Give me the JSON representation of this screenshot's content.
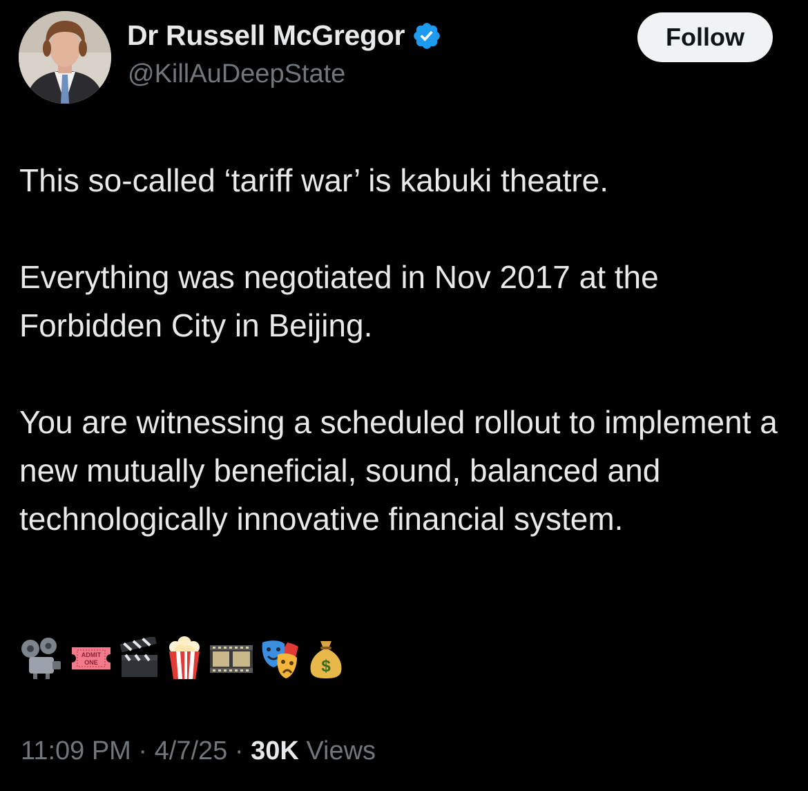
{
  "author": {
    "display_name": "Dr Russell McGregor",
    "handle": "@KillAuDeepState",
    "verified": true,
    "verified_color": "#1d9bf0"
  },
  "follow_button": {
    "label": "Follow"
  },
  "tweet": {
    "paragraphs": [
      "This so-called ‘tariff war’ is kabuki theatre.",
      "Everything was negotiated in Nov 2017 at the Forbidden City in Beijing.",
      "You are witnessing a scheduled rollout to implement a new mutually beneficial, sound, balanced and technologically innovative financial system."
    ],
    "emojis": [
      {
        "name": "film-projector-icon"
      },
      {
        "name": "admission-ticket-icon",
        "text_line1": "ADMIT",
        "text_line2": "ONE"
      },
      {
        "name": "clapper-board-icon"
      },
      {
        "name": "popcorn-icon"
      },
      {
        "name": "film-frames-icon"
      },
      {
        "name": "performing-arts-icon"
      },
      {
        "name": "money-bag-icon",
        "symbol": "$"
      }
    ]
  },
  "meta": {
    "time": "11:09 PM",
    "separator": "·",
    "date": "4/7/25",
    "views_count": "30K",
    "views_label": "Views"
  }
}
